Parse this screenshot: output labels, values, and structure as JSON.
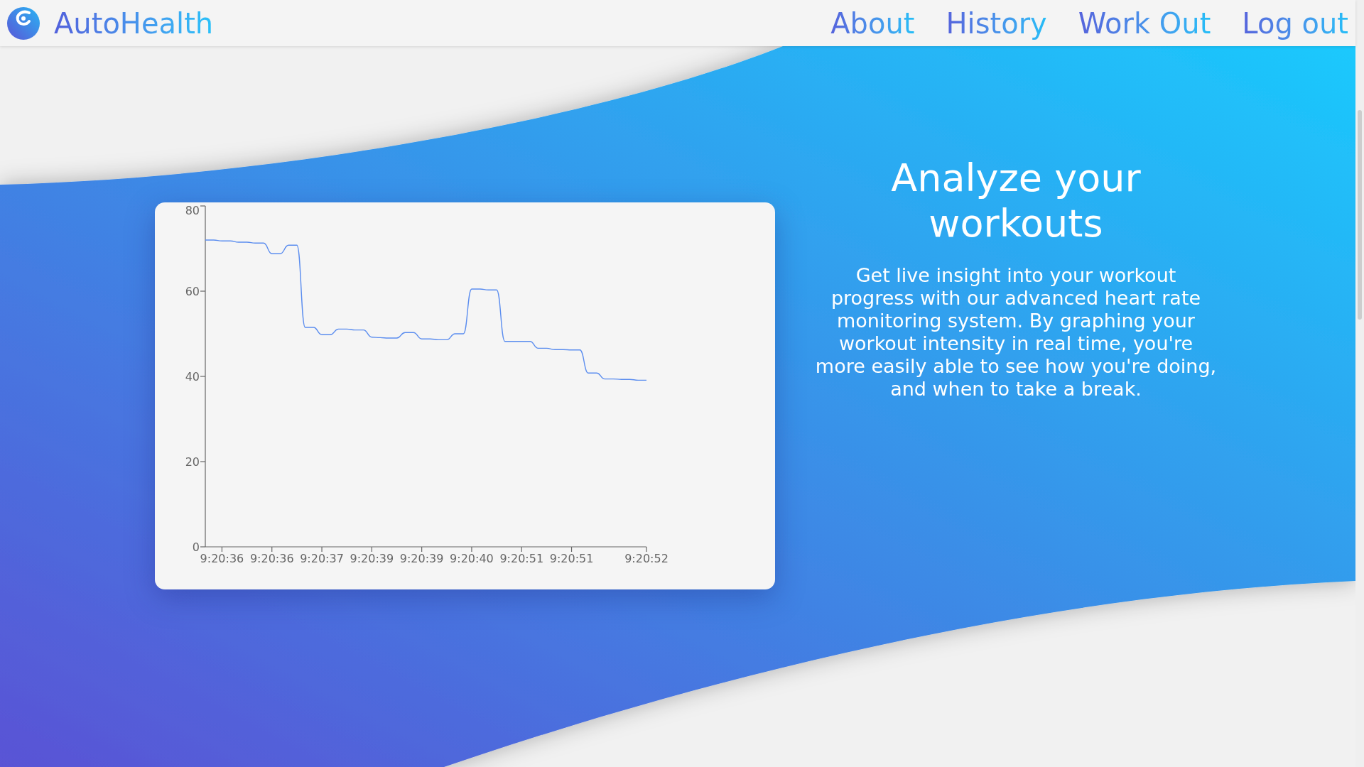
{
  "header": {
    "brand": "AutoHealth",
    "nav": [
      "About",
      "History",
      "Work Out",
      "Log out"
    ]
  },
  "hero": {
    "chart_data": {
      "type": "line",
      "categories": [
        null,
        null,
        "9:20:36",
        null,
        null,
        null,
        null,
        null,
        "9:20:36",
        null,
        null,
        null,
        null,
        null,
        "9:20:37",
        null,
        null,
        null,
        null,
        null,
        "9:20:39",
        null,
        null,
        null,
        null,
        null,
        "9:20:39",
        null,
        null,
        null,
        null,
        null,
        "9:20:40",
        null,
        null,
        null,
        null,
        null,
        "9:20:51",
        null,
        null,
        null,
        null,
        null,
        "9:20:51",
        null,
        null,
        null,
        null,
        null,
        null,
        null,
        null,
        "9:20:52"
      ],
      "values": [
        72,
        72,
        71.8,
        71.8,
        71.5,
        71.5,
        71.3,
        71.3,
        68.8,
        68.8,
        70.8,
        70.8,
        51.5,
        51.5,
        49.8,
        49.8,
        51.1,
        51.1,
        50.9,
        50.9,
        49.2,
        49.1,
        49,
        49,
        50.3,
        50.3,
        48.8,
        48.8,
        48.6,
        48.6,
        50,
        50,
        60.5,
        60.5,
        60.3,
        60.3,
        48.2,
        48.2,
        48.2,
        48.2,
        46.6,
        46.6,
        46.3,
        46.3,
        46.2,
        46.2,
        40.8,
        40.8,
        39.4,
        39.4,
        39.3,
        39.3,
        39.1,
        39.1
      ],
      "color": "#5b8def",
      "ylim": [
        0,
        80
      ],
      "yticks": [
        0,
        20,
        40,
        60,
        80
      ]
    },
    "title_lines": [
      "Analyze your",
      "workouts"
    ],
    "body_lines": [
      "Get live insight into your workout",
      "progress with our advanced heart rate",
      "monitoring system. By graphing your",
      "workout intensity in real time, you're",
      "more easily able to see how you're doing,",
      "and when to take a break."
    ]
  }
}
